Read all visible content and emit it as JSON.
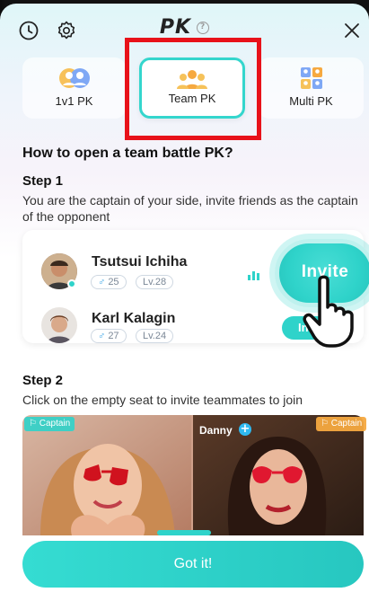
{
  "header": {
    "title": "PK",
    "help_glyph": "?"
  },
  "icons": {
    "history": "clock-icon",
    "settings": "gear-icon",
    "close": "close-icon",
    "help": "help-icon"
  },
  "tabs": [
    {
      "label": "1v1 PK",
      "icon": "two-users-icon",
      "active": false
    },
    {
      "label": "Team PK",
      "icon": "team-icon",
      "active": true
    },
    {
      "label": "Multi PK",
      "icon": "grid-users-icon",
      "active": false
    }
  ],
  "question": "How to open a team battle PK?",
  "step1": {
    "title": "Step 1",
    "description": "You are the captain of your side, invite friends as the captain of the opponent",
    "users": [
      {
        "name": "Tsutsui Ichiha",
        "age": "25",
        "gender_symbol": "♂",
        "level": "Lv.28",
        "invite_label": "Invite"
      },
      {
        "name": "Karl Kalagin",
        "age": "27",
        "gender_symbol": "♂",
        "level": "Lv.24",
        "invite_label": "Invite"
      }
    ]
  },
  "step2": {
    "title": "Step 2",
    "description": "Click on the empty seat to invite teammates to join",
    "seat_left_tag": "Captain",
    "seat_right_tag": "Captain",
    "seat_right_name": "Danny",
    "plus_glyph": "+"
  },
  "confirm_button": "Got it!",
  "colors": {
    "accent": "#2fd3ca",
    "highlight_box": "#e8121a"
  }
}
